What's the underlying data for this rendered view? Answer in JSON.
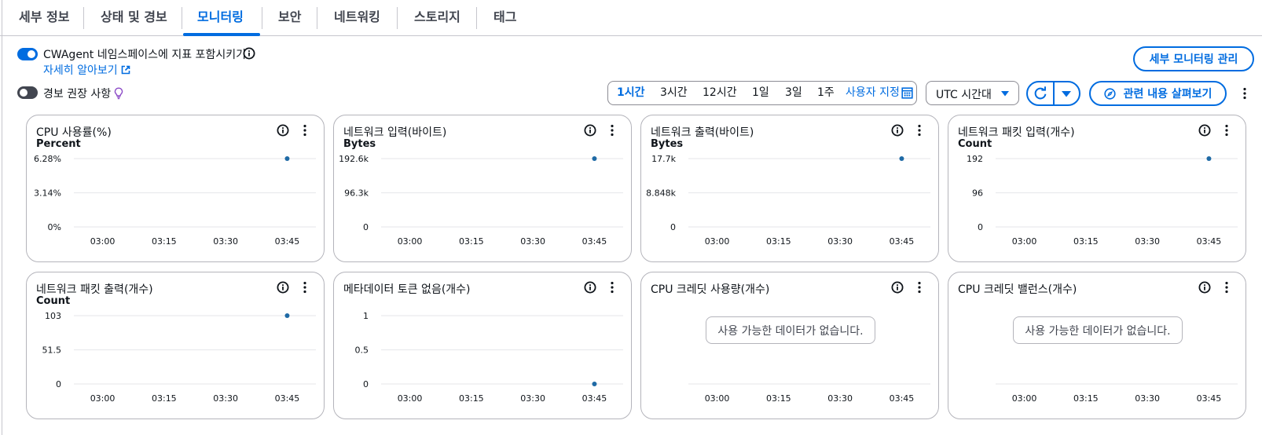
{
  "tabs": [
    {
      "label": "세부 정보",
      "active": false
    },
    {
      "label": "상태 및 경보",
      "active": false
    },
    {
      "label": "모니터링",
      "active": true
    },
    {
      "label": "보안",
      "active": false
    },
    {
      "label": "네트워킹",
      "active": false
    },
    {
      "label": "스토리지",
      "active": false
    },
    {
      "label": "태그",
      "active": false
    }
  ],
  "toolbar": {
    "cwagent_toggle": {
      "label": "CWAgent 네임스페이스에 지표 포함시키기",
      "on": true
    },
    "learn_more": "자세히 알아보기",
    "alarm_toggle": {
      "label": "경보 권장 사항",
      "on": false
    },
    "manage_detailed_monitoring": "세부 모니터링 관리",
    "time_ranges": [
      "1시간",
      "3시간",
      "12시간",
      "1일",
      "3일",
      "1주"
    ],
    "active_range": "1시간",
    "custom_range": "사용자 지정",
    "timezone": "UTC 시간대",
    "explore_related": "관련 내용 살펴보기"
  },
  "colors": {
    "accent": "#006ce0",
    "series": "#1f6aa5",
    "text": "#0f141a",
    "muted": "#424650",
    "border": "#b4b4bb"
  },
  "icons": {
    "info": "info-icon",
    "more": "kebab-menu-icon",
    "external": "external-link-icon",
    "bulb": "lightbulb-icon",
    "calendar": "calendar-icon",
    "refresh": "refresh-icon",
    "dropdown": "caret-down-icon",
    "compass": "compass-icon"
  },
  "no_data_text": "사용 가능한 데이터가 없습니다.",
  "chart_data": [
    {
      "type": "scatter",
      "title": "CPU 사용률(%)",
      "ylabel": "Percent",
      "yticks": [
        "6.28%",
        "3.14%",
        "0%"
      ],
      "ylim": [
        0,
        6.28
      ],
      "xticks": [
        "03:00",
        "03:15",
        "03:30",
        "03:45"
      ],
      "points": [
        {
          "x": "03:45",
          "y": 6.28
        }
      ],
      "has_data": true
    },
    {
      "type": "scatter",
      "title": "네트워크 입력(바이트)",
      "ylabel": "Bytes",
      "yticks": [
        "192.6k",
        "96.3k",
        "0"
      ],
      "ylim": [
        0,
        192600
      ],
      "xticks": [
        "03:00",
        "03:15",
        "03:30",
        "03:45"
      ],
      "points": [
        {
          "x": "03:45",
          "y": 192600
        }
      ],
      "has_data": true
    },
    {
      "type": "scatter",
      "title": "네트워크 출력(바이트)",
      "ylabel": "Bytes",
      "yticks": [
        "17.7k",
        "8.848k",
        "0"
      ],
      "ylim": [
        0,
        17700
      ],
      "xticks": [
        "03:00",
        "03:15",
        "03:30",
        "03:45"
      ],
      "points": [
        {
          "x": "03:45",
          "y": 17700
        }
      ],
      "has_data": true
    },
    {
      "type": "scatter",
      "title": "네트워크 패킷 입력(개수)",
      "ylabel": "Count",
      "yticks": [
        "192",
        "96",
        "0"
      ],
      "ylim": [
        0,
        192
      ],
      "xticks": [
        "03:00",
        "03:15",
        "03:30",
        "03:45"
      ],
      "points": [
        {
          "x": "03:45",
          "y": 192
        }
      ],
      "has_data": true
    },
    {
      "type": "scatter",
      "title": "네트워크 패킷 출력(개수)",
      "ylabel": "Count",
      "yticks": [
        "103",
        "51.5",
        "0"
      ],
      "ylim": [
        0,
        103
      ],
      "xticks": [
        "03:00",
        "03:15",
        "03:30",
        "03:45"
      ],
      "points": [
        {
          "x": "03:45",
          "y": 103
        }
      ],
      "has_data": true
    },
    {
      "type": "scatter",
      "title": "메타데이터 토큰 없음(개수)",
      "ylabel": "",
      "yticks": [
        "1",
        "0.5",
        "0"
      ],
      "ylim": [
        0,
        1
      ],
      "xticks": [
        "03:00",
        "03:15",
        "03:30",
        "03:45"
      ],
      "points": [
        {
          "x": "03:45",
          "y": 0
        }
      ],
      "has_data": true
    },
    {
      "type": "scatter",
      "title": "CPU 크레딧 사용량(개수)",
      "ylabel": "",
      "yticks": [],
      "ylim": null,
      "xticks": [
        "03:00",
        "03:15",
        "03:30",
        "03:45"
      ],
      "points": [],
      "has_data": false
    },
    {
      "type": "scatter",
      "title": "CPU 크레딧 밸런스(개수)",
      "ylabel": "",
      "yticks": [],
      "ylim": null,
      "xticks": [
        "03:00",
        "03:15",
        "03:30",
        "03:45"
      ],
      "points": [],
      "has_data": false
    }
  ]
}
